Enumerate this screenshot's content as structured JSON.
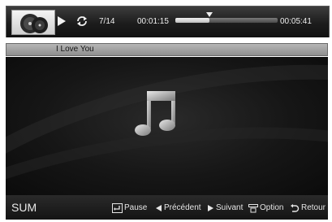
{
  "player": {
    "track_counter": "7/14",
    "elapsed_time": "00:01:15",
    "total_time": "00:05:41",
    "progress_fraction": 0.33
  },
  "now_playing": {
    "title": "I Love You"
  },
  "footer": {
    "source": "SUM",
    "hints": {
      "pause": "Pause",
      "previous": "Précédent",
      "next": "Suivant",
      "option": "Option",
      "return": "Retour"
    }
  },
  "icons": {
    "play": "play-icon",
    "repeat": "repeat-icon",
    "album_art": "album-thumbnail",
    "music_note": "music-note-icon",
    "pause_hint": "enter-key-icon",
    "previous_hint": "left-arrow-icon",
    "next_hint": "right-arrow-icon",
    "option_hint": "tools-icon",
    "return_hint": "return-icon"
  },
  "colors": {
    "background": "#0b0b0b",
    "bar": "#1c1c1c",
    "title_bar": "#a3a3a3",
    "text": "#eeeeee"
  }
}
